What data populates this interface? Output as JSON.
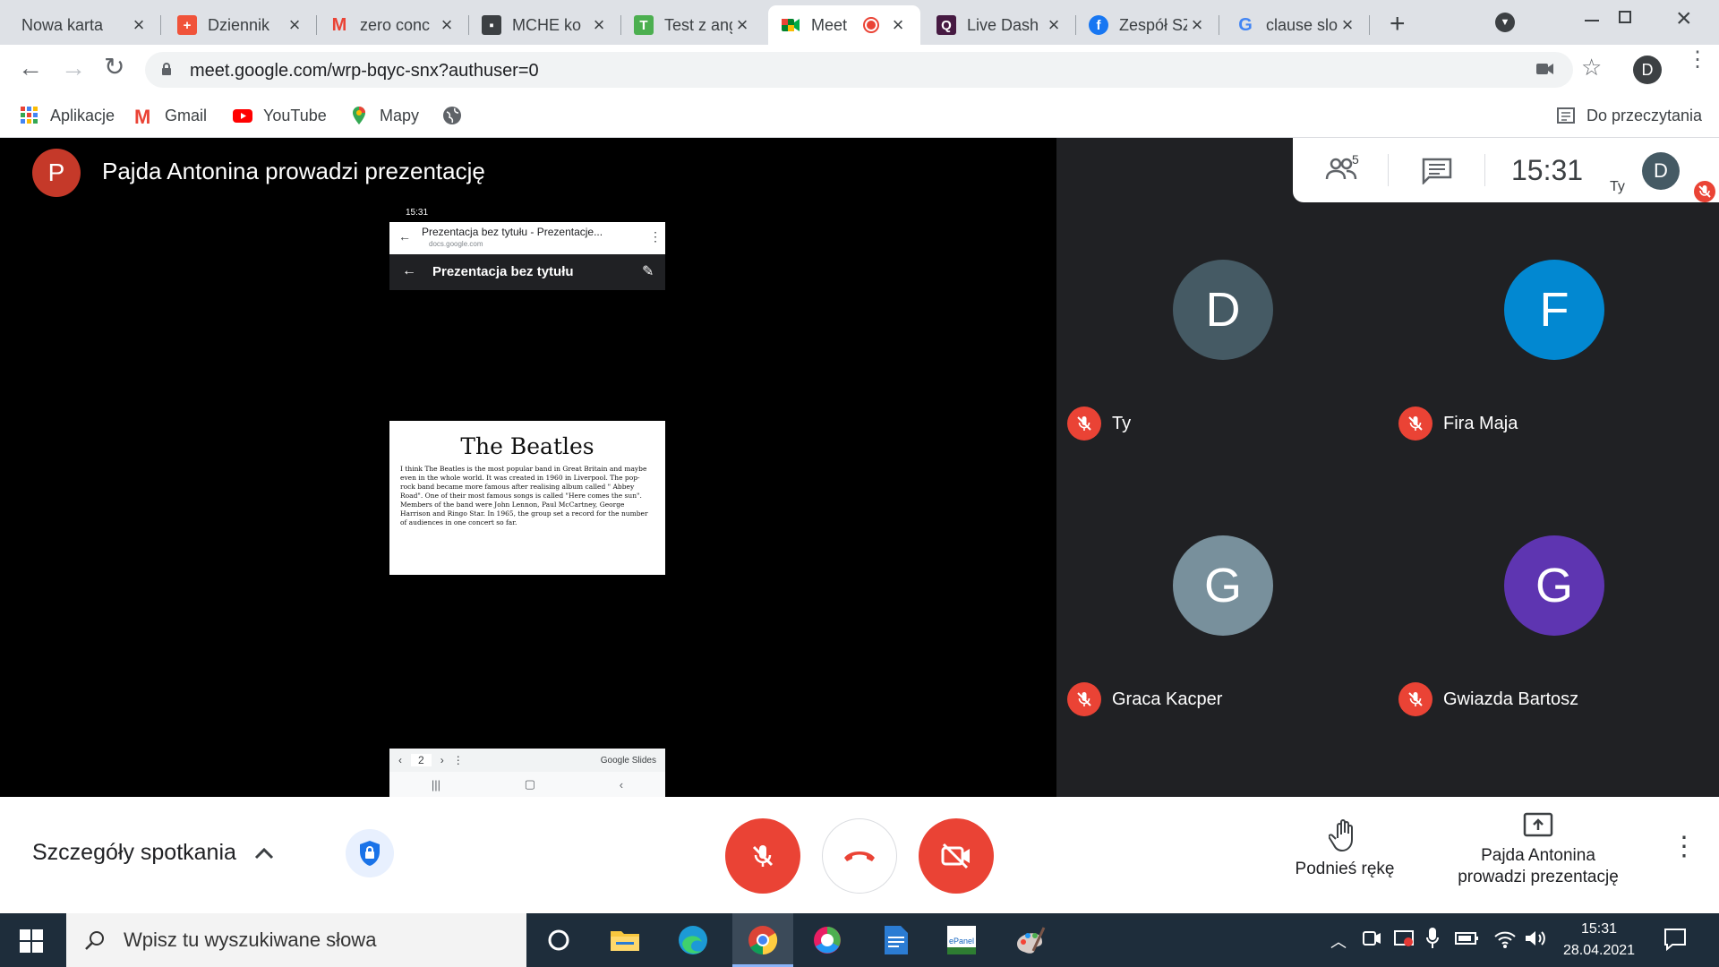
{
  "browser": {
    "tabs": [
      {
        "title": "Nowa karta",
        "favicon": "none",
        "color": ""
      },
      {
        "title": "Dziennik",
        "favicon": "plus-tile-icon",
        "color": "#f0533a"
      },
      {
        "title": "zero conc",
        "favicon": "gmail-icon",
        "color": "#ea4335"
      },
      {
        "title": "MCHE ko",
        "favicon": "contact-card-icon",
        "color": "#3c4043"
      },
      {
        "title": "Test z ang",
        "favicon": "testportal-icon",
        "color": "#4caf50"
      },
      {
        "title": "Meet",
        "favicon": "meet-icon",
        "color": "#00832d"
      },
      {
        "title": "Live Dash",
        "favicon": "quizizz-icon",
        "color": "#461a42"
      },
      {
        "title": "Zespół SZ",
        "favicon": "facebook-icon",
        "color": "#1877f2"
      },
      {
        "title": "clause slo",
        "favicon": "google-icon",
        "color": "#4285f4"
      }
    ],
    "url": "meet.google.com/wrp-bqyc-snx?authuser=0",
    "profile_initial": "D",
    "bookmarks": [
      "Aplikacje",
      "Gmail",
      "YouTube",
      "Mapy"
    ],
    "reading_list": "Do przeczytania"
  },
  "meet": {
    "presenter_initial": "P",
    "presenter_title": "Pajda Antonina prowadzi prezentację",
    "participants_count": "5",
    "clock": "15:31",
    "self_label": "Ty",
    "self_initial": "D",
    "phone": {
      "status_time": "15:31",
      "doc_title": "Prezentacja bez tytułu - Prezentacje...",
      "doc_url": "docs.google.com",
      "slides_title": "Prezentacja bez tytułu",
      "slide_heading": "The Beatles",
      "slide_body": "I think The Beatles is the most popular band in Great Britain and maybe even in the whole world. It was created in 1960 in Liverpool. The pop-rock band became more famous after realising album called \" Abbey Road\". One of their most famous songs is called \"Here comes the sun\". Members of the band were John Lennon, Paul McCartney, George Harrison and Ringo Star. In 1965, the group set a record for the number of audiences in one concert so far.",
      "page_number": "2",
      "slides_brand": "Google Slides"
    },
    "tiles": [
      {
        "initial": "D",
        "name": "Ty",
        "color": "#455a64"
      },
      {
        "initial": "F",
        "name": "Fira Maja",
        "color": "#0288d1"
      },
      {
        "initial": "G",
        "name": "Graca Kacper",
        "color": "#78909c"
      },
      {
        "initial": "G",
        "name": "Gwiazda Bartosz",
        "color": "#5e35b1"
      }
    ],
    "meeting_details": "Szczegóły spotkania",
    "raise_hand": "Podnieś rękę",
    "presenting_line1": "Pajda Antonina",
    "presenting_line2": "prowadzi prezentację"
  },
  "taskbar": {
    "search_placeholder": "Wpisz tu wyszukiwane słowa",
    "time": "15:31",
    "date": "28.04.2021"
  },
  "colors": {
    "red": "#ea4335",
    "meet_bg": "#202124",
    "taskbar": "#1e2d3b"
  }
}
